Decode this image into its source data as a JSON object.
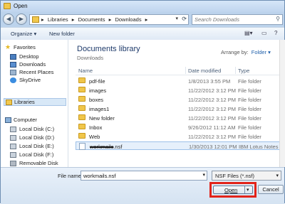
{
  "window": {
    "title": "Open"
  },
  "address": {
    "crumbs": [
      "Libraries",
      "▸",
      "Documents",
      "▸",
      "Downloads",
      "▸"
    ]
  },
  "search": {
    "placeholder": "Search Downloads"
  },
  "toolbar": {
    "organize": "Organize ▾",
    "new_folder": "New folder"
  },
  "nav": {
    "favorites": "Favorites",
    "items_fav": [
      "Desktop",
      "Downloads",
      "Recent Places",
      "SkyDrive"
    ],
    "libraries": "Libraries",
    "computer": "Computer",
    "drives": [
      "Local Disk (C:)",
      "Local Disk (D:)",
      "Local Disk (E:)",
      "Local Disk (F:)",
      "Removable Disk"
    ]
  },
  "library": {
    "title": "Documents library",
    "subtitle": "Downloads",
    "arrange_label": "Arrange by:",
    "arrange_value": "Folder ▾"
  },
  "columns": {
    "name": "Name",
    "date": "Date modified",
    "type": "Type"
  },
  "files": [
    {
      "name": "pdf-file",
      "date": "1/8/2013 3:55 PM",
      "type": "File folder"
    },
    {
      "name": "images",
      "date": "11/22/2012 3:12 PM",
      "type": "File folder"
    },
    {
      "name": "boxes",
      "date": "11/22/2012 3:12 PM",
      "type": "File folder"
    },
    {
      "name": "images1",
      "date": "11/22/2012 3:12 PM",
      "type": "File folder"
    },
    {
      "name": "New folder",
      "date": "11/22/2012 3:12 PM",
      "type": "File folder"
    },
    {
      "name": "Inbox",
      "date": "9/26/2012 11:12 AM",
      "type": "File folder"
    },
    {
      "name": "Web",
      "date": "11/22/2012 3:12 PM",
      "type": "File folder"
    }
  ],
  "selected_file": {
    "name_hidden": "workmails",
    "ext": ".nsf",
    "date": "1/30/2013 12:01 PM",
    "type": "IBM Lotus Notes d..."
  },
  "footer": {
    "file_name_label": "File name:",
    "file_name_value": "workmails.nsf",
    "filter": "NSF Files (*.nsf)",
    "open": "Open",
    "cancel": "Cancel"
  },
  "colors": {
    "folder": "#f0c64a",
    "highlight": "#e2231a",
    "accent": "#1e3a6a"
  }
}
